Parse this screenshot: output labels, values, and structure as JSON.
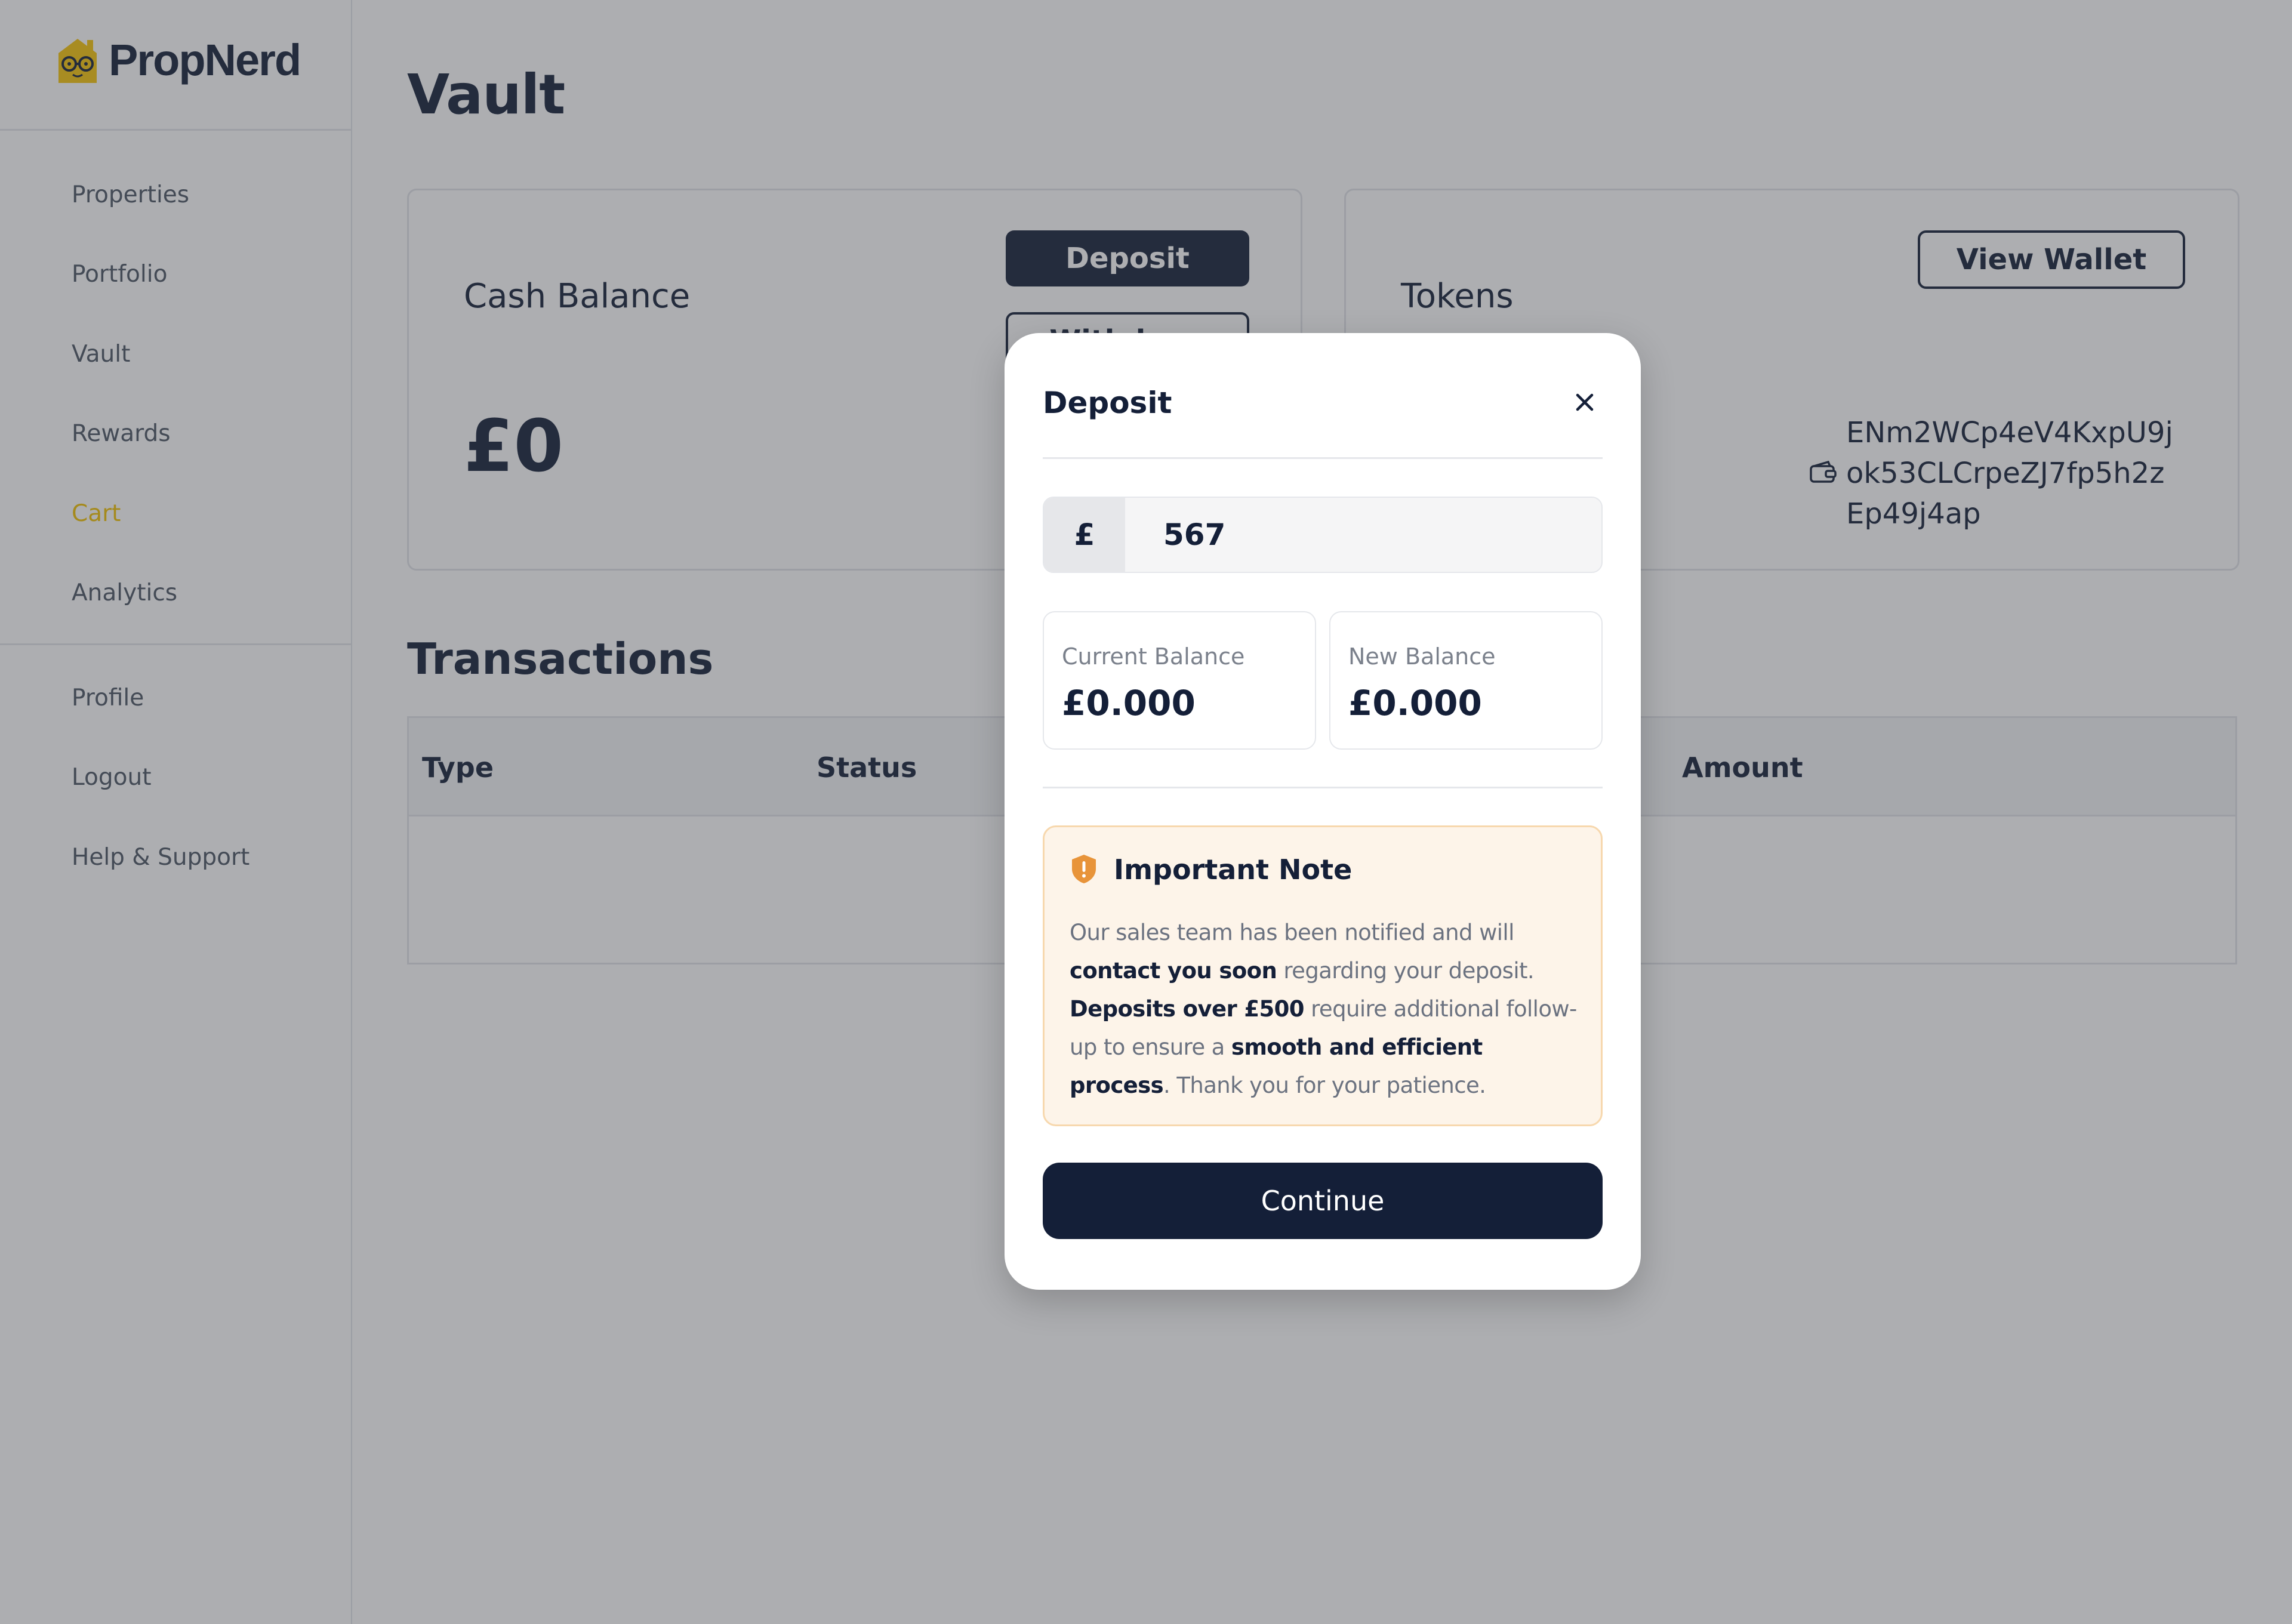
{
  "app": {
    "brand": "PropNerd"
  },
  "sidebar": {
    "items": [
      {
        "label": "Properties"
      },
      {
        "label": "Portfolio"
      },
      {
        "label": "Vault"
      },
      {
        "label": "Rewards"
      },
      {
        "label": "Cart"
      },
      {
        "label": "Analytics"
      }
    ],
    "secondary": [
      {
        "label": "Profile"
      },
      {
        "label": "Logout"
      },
      {
        "label": "Help & Support"
      }
    ],
    "active_color": "#f2c200"
  },
  "page": {
    "title": "Vault",
    "cash_card": {
      "label": "Cash Balance",
      "amount": "£0",
      "deposit_label": "Deposit",
      "withdraw_label": "Withdraw"
    },
    "tokens_card": {
      "label": "Tokens",
      "view_wallet_label": "View Wallet",
      "address": "ENm2WCp4eV4KxpU9jok53CLCrpeZJ7fp5h2zEp49j4ap"
    },
    "transactions": {
      "title": "Transactions",
      "columns": [
        "Type",
        "Status",
        "Amount"
      ]
    }
  },
  "modal": {
    "title": "Deposit",
    "currency_symbol": "£",
    "amount_value": "567",
    "current_balance_label": "Current Balance",
    "current_balance_value": "£0.000",
    "new_balance_label": "New Balance",
    "new_balance_value": "£0.000",
    "note_title": "Important Note",
    "note": {
      "t1": "Our sales team has been notified and will ",
      "b1": "contact you soon",
      "t2": " regarding your deposit. ",
      "b2": "Deposits over £500",
      "t3": " require additional follow-up to ensure a ",
      "b3": "smooth and efficient process",
      "t4": ". Thank you for your patience."
    },
    "continue_label": "Continue"
  },
  "colors": {
    "navy": "#141f38",
    "accent_yellow": "#f2c200",
    "note_bg": "#fdf4e9",
    "note_border": "#f7d8ae",
    "warning_orange": "#e8943a"
  }
}
